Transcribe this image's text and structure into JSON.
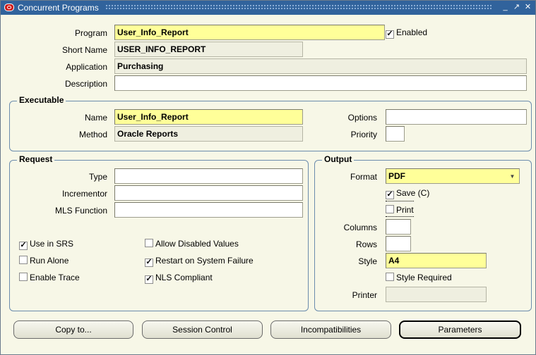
{
  "window": {
    "title": "Concurrent Programs",
    "controls": [
      "_",
      "↗",
      "✕"
    ]
  },
  "program": {
    "program_label": "Program",
    "program_value": "User_Info_Report",
    "enabled_label": "Enabled",
    "enabled_checked": true,
    "short_name_label": "Short Name",
    "short_name_value": "USER_INFO_REPORT",
    "application_label": "Application",
    "application_value": "Purchasing",
    "description_label": "Description",
    "description_value": ""
  },
  "executable": {
    "title": "Executable",
    "name_label": "Name",
    "name_value": "User_Info_Report",
    "method_label": "Method",
    "method_value": "Oracle Reports",
    "options_label": "Options",
    "options_value": "",
    "priority_label": "Priority",
    "priority_value": ""
  },
  "request": {
    "title": "Request",
    "type_label": "Type",
    "type_value": "",
    "incrementor_label": "Incrementor",
    "incrementor_value": "",
    "mls_label": "MLS Function",
    "mls_value": "",
    "use_in_srs": "Use in SRS",
    "run_alone": "Run Alone",
    "enable_trace": "Enable Trace",
    "allow_disabled": "Allow Disabled Values",
    "restart_failure": "Restart on System Failure",
    "nls_compliant": "NLS Compliant"
  },
  "output": {
    "title": "Output",
    "format_label": "Format",
    "format_value": "PDF",
    "save_label": "Save (C)",
    "print_label": "Print",
    "columns_label": "Columns",
    "columns_value": "",
    "rows_label": "Rows",
    "rows_value": "",
    "style_label": "Style",
    "style_value": "A4",
    "style_required_label": "Style Required",
    "printer_label": "Printer",
    "printer_value": ""
  },
  "buttons": {
    "copy": "Copy to...",
    "session": "Session Control",
    "incompat": "Incompatibilities",
    "params": "Parameters"
  },
  "colors": {
    "title_bar": "#31639c",
    "required_field": "#ffff99",
    "background": "#f7f7e7"
  }
}
